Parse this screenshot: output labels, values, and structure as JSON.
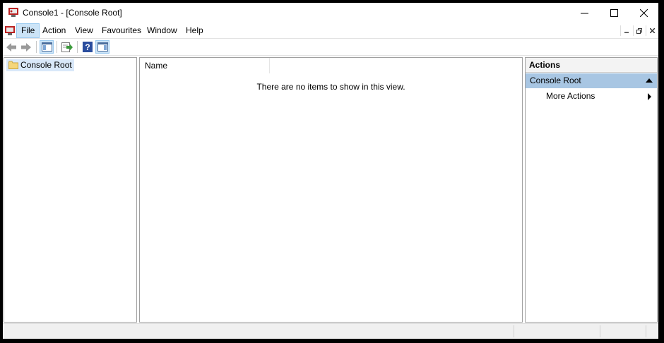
{
  "window": {
    "title": "Console1 - [Console Root]",
    "controls": {
      "minimize": "minimize-icon",
      "maximize": "maximize-icon",
      "close": "close-icon"
    }
  },
  "menubar": {
    "items": [
      {
        "label": "File",
        "active": true
      },
      {
        "label": "Action"
      },
      {
        "label": "View"
      },
      {
        "label": "Favourites"
      },
      {
        "label": "Window"
      },
      {
        "label": "Help"
      }
    ],
    "mdi_controls": [
      "minimize-icon",
      "restore-icon",
      "close-icon"
    ]
  },
  "toolbar": {
    "buttons": [
      "back-arrow-icon",
      "forward-arrow-icon",
      "show-hide-console-tree-icon",
      "export-list-icon",
      "help-icon",
      "show-hide-action-pane-icon"
    ]
  },
  "tree": {
    "root_label": "Console Root"
  },
  "list": {
    "column_name": "Name",
    "empty_message": "There are no items to show in this view."
  },
  "actions": {
    "header": "Actions",
    "group_label": "Console Root",
    "more_actions": "More Actions"
  },
  "colors": {
    "selection": "#cce4f7",
    "actions_group": "#a8c6e3",
    "tree_selection": "#d9e8f9"
  }
}
